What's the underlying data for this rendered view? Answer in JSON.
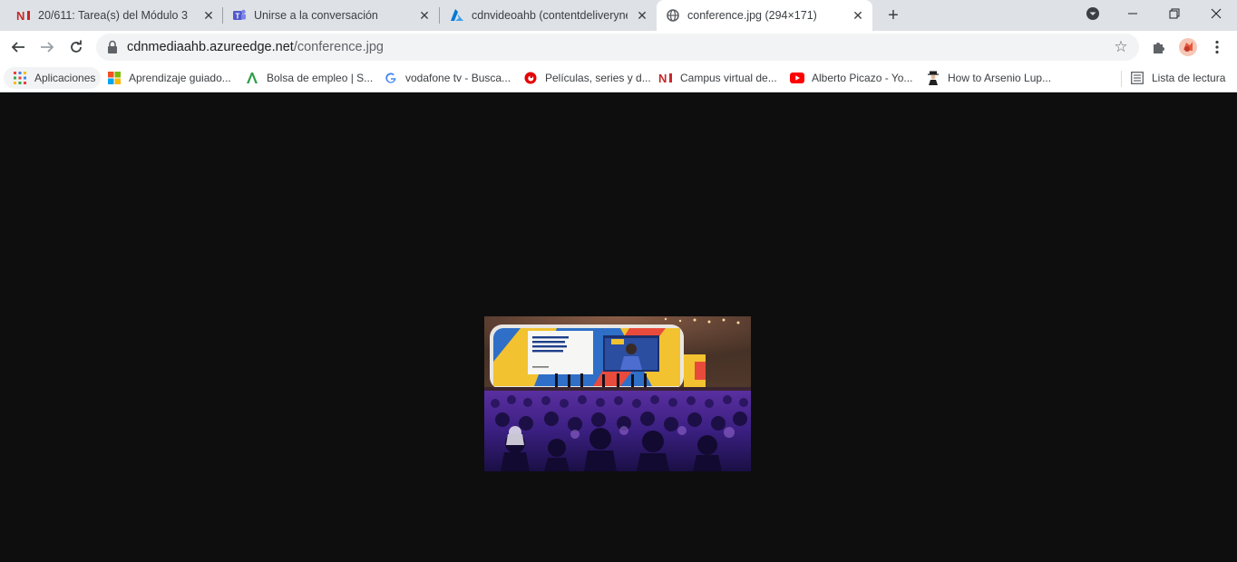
{
  "tabs": [
    {
      "title": "20/611: Tarea(s) del Módulo 3",
      "favicon": "ni-icon"
    },
    {
      "title": "Unirse a la conversación",
      "favicon": "teams-icon"
    },
    {
      "title": "cdnvideoahb (contentdeliverynet",
      "favicon": "azure-icon"
    },
    {
      "title": "conference.jpg (294×171)",
      "favicon": "globe-icon",
      "active": true
    }
  ],
  "address": {
    "host": "cdnmediaahb.azureedge.net",
    "path": "/conference.jpg"
  },
  "bookmarks": {
    "apps_label": "Aplicaciones",
    "items": [
      {
        "label": "Aprendizaje guiado...",
        "icon": "microsoft-icon"
      },
      {
        "label": "Bolsa de empleo | S...",
        "icon": "green-a-icon"
      },
      {
        "label": "vodafone tv - Busca...",
        "icon": "google-icon"
      },
      {
        "label": "Películas, series y d...",
        "icon": "vodafone-icon"
      },
      {
        "label": "Campus virtual de...",
        "icon": "ni-icon"
      },
      {
        "label": "Alberto Picazo - Yo...",
        "icon": "youtube-icon"
      },
      {
        "label": "How to Arsenio Lup...",
        "icon": "person-icon"
      }
    ],
    "reading_list_label": "Lista de lectura"
  },
  "image": {
    "name": "conference.jpg",
    "screen_text": "Voice of the Youth: Ground Realities in the Age of Disruption"
  },
  "colors": {
    "brand_ni": "#c62828",
    "teams": "#5059c9",
    "azure": "#0078d4",
    "youtube": "#ff0000",
    "vodafone": "#e60000",
    "profile": "#e8583a"
  }
}
